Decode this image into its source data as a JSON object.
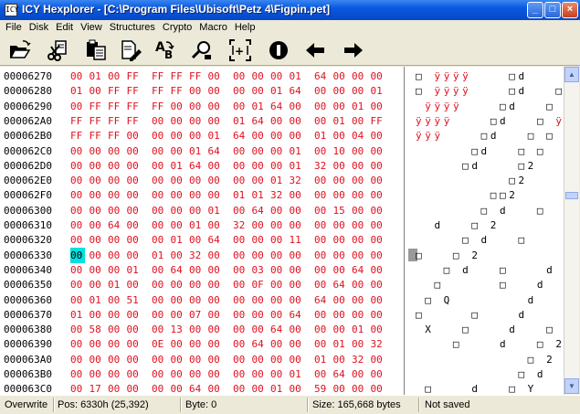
{
  "window": {
    "title": "ICY Hexplorer - [C:\\Program Files\\Ubisoft\\Petz 4\\Figpin.pet]",
    "icon": "app-icon",
    "controls": [
      "minimize",
      "maximize",
      "close"
    ]
  },
  "menu": [
    "File",
    "Disk",
    "Edit",
    "View",
    "Structures",
    "Crypto",
    "Macro",
    "Help"
  ],
  "toolbar": [
    "open-icon",
    "cut-icon",
    "paste-icon",
    "edit-icon",
    "find-icon",
    "replace-icon",
    "goto-icon",
    "stop-icon",
    "back-icon",
    "forward-icon"
  ],
  "hex_rows": [
    {
      "addr": "00006270",
      "bytes": [
        "00",
        "01",
        "00",
        "FF",
        "FF",
        "FF",
        "FF",
        "00",
        "00",
        "00",
        "00",
        "01",
        "64",
        "00",
        "00",
        "00"
      ],
      "text": "□ ÿÿÿÿ    □d   "
    },
    {
      "addr": "00006280",
      "bytes": [
        "01",
        "00",
        "FF",
        "FF",
        "FF",
        "FF",
        "00",
        "00",
        "00",
        "00",
        "01",
        "64",
        "00",
        "00",
        "00",
        "01"
      ],
      "text": "□ ÿÿÿÿ    □d   □"
    },
    {
      "addr": "00006290",
      "bytes": [
        "00",
        "FF",
        "FF",
        "FF",
        "FF",
        "00",
        "00",
        "00",
        "00",
        "01",
        "64",
        "00",
        "00",
        "00",
        "01",
        "00"
      ],
      "text": " ÿÿÿÿ    □d   □ "
    },
    {
      "addr": "000062A0",
      "bytes": [
        "FF",
        "FF",
        "FF",
        "FF",
        "00",
        "00",
        "00",
        "00",
        "01",
        "64",
        "00",
        "00",
        "00",
        "01",
        "00",
        "FF"
      ],
      "text": "ÿÿÿÿ    □d   □ ÿ"
    },
    {
      "addr": "000062B0",
      "bytes": [
        "FF",
        "FF",
        "FF",
        "00",
        "00",
        "00",
        "00",
        "01",
        "64",
        "00",
        "00",
        "00",
        "01",
        "00",
        "04",
        "00"
      ],
      "text": "ÿÿÿ    □d   □ □ "
    },
    {
      "addr": "000062C0",
      "bytes": [
        "00",
        "00",
        "00",
        "00",
        "00",
        "00",
        "01",
        "64",
        "00",
        "00",
        "00",
        "01",
        "00",
        "10",
        "00",
        "00"
      ],
      "text": "      □d   □ □  "
    },
    {
      "addr": "000062D0",
      "bytes": [
        "00",
        "00",
        "00",
        "00",
        "00",
        "01",
        "64",
        "00",
        "00",
        "00",
        "00",
        "01",
        "32",
        "00",
        "00",
        "00"
      ],
      "text": "     □d    □2   "
    },
    {
      "addr": "000062E0",
      "bytes": [
        "00",
        "00",
        "00",
        "00",
        "00",
        "00",
        "00",
        "00",
        "00",
        "00",
        "01",
        "32",
        "00",
        "00",
        "00",
        "00"
      ],
      "text": "          □2    "
    },
    {
      "addr": "000062F0",
      "bytes": [
        "00",
        "00",
        "00",
        "00",
        "00",
        "00",
        "00",
        "00",
        "01",
        "01",
        "32",
        "00",
        "00",
        "00",
        "00",
        "00"
      ],
      "text": "        □□2     "
    },
    {
      "addr": "00006300",
      "bytes": [
        "00",
        "00",
        "00",
        "00",
        "00",
        "00",
        "00",
        "01",
        "00",
        "64",
        "00",
        "00",
        "00",
        "15",
        "00",
        "00"
      ],
      "text": "       □ d   □  "
    },
    {
      "addr": "00006310",
      "bytes": [
        "00",
        "00",
        "64",
        "00",
        "00",
        "00",
        "01",
        "00",
        "32",
        "00",
        "00",
        "00",
        "00",
        "00",
        "00",
        "00"
      ],
      "text": "  d   □ 2       "
    },
    {
      "addr": "00006320",
      "bytes": [
        "00",
        "00",
        "00",
        "00",
        "00",
        "01",
        "00",
        "64",
        "00",
        "00",
        "00",
        "11",
        "00",
        "00",
        "00",
        "00"
      ],
      "text": "     □ d   □    "
    },
    {
      "addr": "00006330",
      "bytes": [
        "00",
        "00",
        "00",
        "00",
        "01",
        "00",
        "32",
        "00",
        "00",
        "00",
        "00",
        "00",
        "00",
        "00",
        "00",
        "00"
      ],
      "text": "□   □ 2         "
    },
    {
      "addr": "00006340",
      "bytes": [
        "00",
        "00",
        "00",
        "01",
        "00",
        "64",
        "00",
        "00",
        "00",
        "03",
        "00",
        "00",
        "00",
        "00",
        "64",
        "00"
      ],
      "text": "   □ d   □    d "
    },
    {
      "addr": "00006350",
      "bytes": [
        "00",
        "00",
        "01",
        "00",
        "00",
        "00",
        "00",
        "00",
        "00",
        "0F",
        "00",
        "00",
        "00",
        "64",
        "00",
        "00"
      ],
      "text": "  □      □   d  "
    },
    {
      "addr": "00006360",
      "bytes": [
        "00",
        "01",
        "00",
        "51",
        "00",
        "00",
        "00",
        "00",
        "00",
        "00",
        "00",
        "00",
        "64",
        "00",
        "00",
        "00"
      ],
      "text": " □ Q        d   "
    },
    {
      "addr": "00006370",
      "bytes": [
        "01",
        "00",
        "00",
        "00",
        "00",
        "00",
        "07",
        "00",
        "00",
        "00",
        "00",
        "64",
        "00",
        "00",
        "00",
        "00"
      ],
      "text": "□     □    d    "
    },
    {
      "addr": "00006380",
      "bytes": [
        "00",
        "58",
        "00",
        "00",
        "00",
        "13",
        "00",
        "00",
        "00",
        "00",
        "64",
        "00",
        "00",
        "00",
        "01",
        "00"
      ],
      "text": " X   □    d   □ "
    },
    {
      "addr": "00006390",
      "bytes": [
        "00",
        "00",
        "00",
        "00",
        "0E",
        "00",
        "00",
        "00",
        "00",
        "64",
        "00",
        "00",
        "00",
        "01",
        "00",
        "32"
      ],
      "text": "    □    d   □ 2"
    },
    {
      "addr": "000063A0",
      "bytes": [
        "00",
        "00",
        "00",
        "00",
        "00",
        "00",
        "00",
        "00",
        "00",
        "00",
        "00",
        "00",
        "01",
        "00",
        "32",
        "00"
      ],
      "text": "            □ 2 "
    },
    {
      "addr": "000063B0",
      "bytes": [
        "00",
        "00",
        "00",
        "00",
        "00",
        "00",
        "00",
        "00",
        "00",
        "00",
        "00",
        "01",
        "00",
        "64",
        "00",
        "00"
      ],
      "text": "           □ d  "
    },
    {
      "addr": "000063C0",
      "bytes": [
        "00",
        "17",
        "00",
        "00",
        "00",
        "00",
        "64",
        "00",
        "00",
        "00",
        "01",
        "00",
        "59",
        "00",
        "00",
        "00"
      ],
      "text": " □    d   □ Y   "
    }
  ],
  "status": {
    "mode": "Overwrite",
    "pos": "Pos: 6330h (25,392)",
    "byte": "Byte: 0",
    "size": "Size: 165,668 bytes",
    "saved": "Not saved"
  },
  "colors": {
    "title_bar": "#0a58e0",
    "hex_nonzero": "#e0101e",
    "selection": "#00e0e0"
  }
}
